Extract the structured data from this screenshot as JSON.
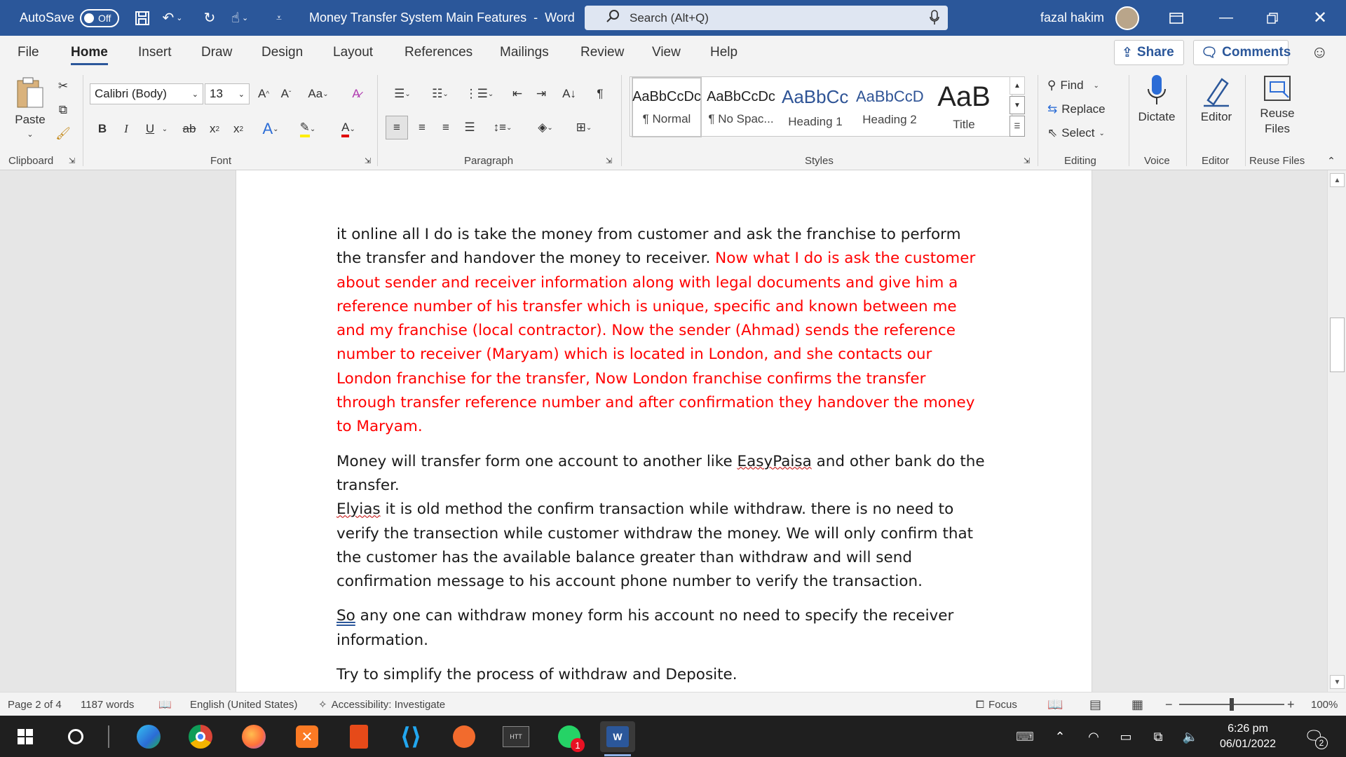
{
  "titlebar": {
    "autosave_label": "AutoSave",
    "autosave_state": "Off",
    "doc_title": "Money Transfer System Main Features",
    "separator": "-",
    "app_name": "Word",
    "search_placeholder": "Search (Alt+Q)",
    "user_name": "fazal hakim",
    "accent": "#2b579a"
  },
  "tabs": [
    "File",
    "Home",
    "Insert",
    "Draw",
    "Design",
    "Layout",
    "References",
    "Mailings",
    "Review",
    "View",
    "Help"
  ],
  "tab_actions": {
    "share": "Share",
    "comments": "Comments"
  },
  "ribbon": {
    "clipboard": {
      "paste": "Paste",
      "label": "Clipboard"
    },
    "font": {
      "name": "Calibri (Body)",
      "size": "13",
      "label": "Font",
      "change_case": "Aa",
      "bold": "B",
      "italic": "I",
      "underline": "U",
      "strike": "ab",
      "sub": "x",
      "sup": "x",
      "font_color": "A"
    },
    "paragraph": {
      "label": "Paragraph"
    },
    "styles": {
      "label": "Styles",
      "items": [
        {
          "preview": "AaBbCcDc",
          "name": "¶ Normal"
        },
        {
          "preview": "AaBbCcDc",
          "name": "¶ No Spac..."
        },
        {
          "preview": "AaBbCc",
          "name": "Heading 1"
        },
        {
          "preview": "AaBbCcD",
          "name": "Heading 2"
        },
        {
          "preview": "AaB",
          "name": "Title"
        }
      ]
    },
    "editing": {
      "find": "Find",
      "replace": "Replace",
      "select": "Select",
      "label": "Editing"
    },
    "voice": {
      "dictate": "Dictate",
      "label": "Voice"
    },
    "editor": {
      "editor": "Editor",
      "label": "Editor"
    },
    "reuse": {
      "line1": "Reuse",
      "line2": "Files",
      "label": "Reuse Files"
    }
  },
  "document": {
    "p1_black": "it online all I do is take the money from customer and ask the franchise to perform the transfer and handover the money to receiver.",
    "p1_red": "Now what I do is ask the customer about sender and receiver information along with legal documents and give him a reference number of his transfer which is unique, specific and known between me and my franchise (local contractor). Now the sender (Ahmad) sends the reference number to receiver (Maryam) which is located in London, and she contacts our London franchise for the transfer, Now London franchise confirms the transfer through transfer reference number and after confirmation they handover the money to Maryam.",
    "p2_a": "Money will transfer form one account to another like",
    "p2_easypaisa": "EasyPaisa",
    "p2_b": "and other bank do the transfer.",
    "p2_elyias": "Elyias",
    "p2_c": "it is old method the confirm transaction while withdraw. there is no need to verify the transection while customer withdraw the money. We will only confirm that the customer has the available balance greater than withdraw and will send confirmation message to his account phone number to verify the transaction.",
    "p3_so": "So",
    "p3_rest": "any one can withdraw money form his account no need to specify the receiver information.",
    "p4": "Try to simplify the process of withdraw and Deposite."
  },
  "status": {
    "page": "Page 2 of 4",
    "words": "1187 words",
    "language": "English (United States)",
    "accessibility": "Accessibility: Investigate",
    "focus": "Focus",
    "zoom": "100%"
  },
  "taskbar": {
    "time": "6:26 pm",
    "date": "06/01/2022",
    "notif_count": "2",
    "whatsapp_badge": "1"
  }
}
